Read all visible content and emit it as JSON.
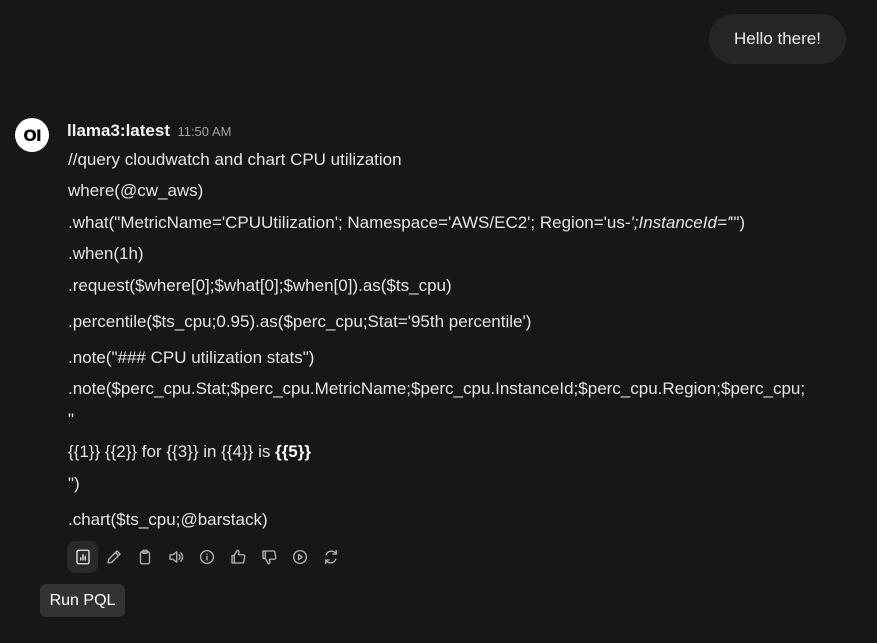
{
  "user_message": {
    "text": "Hello there!"
  },
  "assistant": {
    "avatar_text": "OI",
    "model": "llama3:latest",
    "time": "11:50 AM",
    "lines": {
      "l1": "//query cloudwatch and chart CPU utilization",
      "l2": "where(@cw_aws)",
      "l3_pre": ".what(\"MetricName='CPUUtilization'; Namespace='AWS/EC2'; Region='us-",
      "l3_em": "';InstanceId='",
      "l3_post": "'\")",
      "l4": ".when(1h)",
      "l5": ".request($where[0];$what[0];$when[0]).as($ts_cpu)",
      "l6": ".percentile($ts_cpu;0.95).as($perc_cpu;Stat='95th percentile')",
      "l7": ".note(\"### CPU utilization stats\")",
      "l8": ".note($perc_cpu.Stat;$perc_cpu.MetricName;$perc_cpu.InstanceId;$perc_cpu.Region;$perc_cpu;",
      "l9": "\"",
      "l10_pre": "{{1}} {{2}} for {{3}} in {{4}} is ",
      "l10_bold": "{{5}}",
      "l11": "\")",
      "l12": ".chart($ts_cpu;@barstack)"
    }
  },
  "toolbar": {
    "buttons": [
      {
        "icon": "bar-chart-icon",
        "active": true
      },
      {
        "icon": "pencil-icon",
        "active": false
      },
      {
        "icon": "clipboard-icon",
        "active": false
      },
      {
        "icon": "speaker-icon",
        "active": false
      },
      {
        "icon": "info-icon",
        "active": false
      },
      {
        "icon": "thumbs-up-icon",
        "active": false
      },
      {
        "icon": "thumbs-down-icon",
        "active": false
      },
      {
        "icon": "play-circle-icon",
        "active": false
      },
      {
        "icon": "refresh-icon",
        "active": false
      }
    ],
    "tooltip": "Run PQL"
  }
}
